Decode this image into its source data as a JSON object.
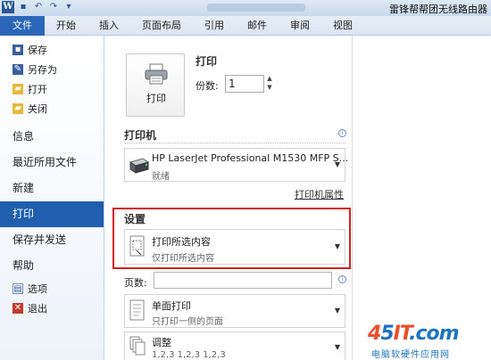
{
  "titlebar": {
    "brand": "雷锋帮帮团无线路由器"
  },
  "ribbon_tabs": [
    "文件",
    "开始",
    "插入",
    "页面布局",
    "引用",
    "邮件",
    "审阅",
    "视图"
  ],
  "nav": {
    "small_top": [
      {
        "icon": "save-icon",
        "label": "保存"
      },
      {
        "icon": "save-as-icon",
        "label": "另存为"
      },
      {
        "icon": "open-folder-icon",
        "label": "打开"
      },
      {
        "icon": "close-folder-icon",
        "label": "关闭"
      }
    ],
    "big": [
      "信息",
      "最近所用文件",
      "新建",
      "打印",
      "保存并发送",
      "帮助"
    ],
    "active": "打印",
    "small_bottom": [
      {
        "icon": "options-icon",
        "label": "选项"
      },
      {
        "icon": "exit-icon",
        "label": "退出"
      }
    ]
  },
  "print": {
    "section_title": "打印",
    "button_label": "打印",
    "copies_label": "份数:",
    "copies_value": "1"
  },
  "printer": {
    "section_title": "打印机",
    "name": "HP LaserJet Professional M1530 MFP S...",
    "status": "就绪",
    "properties_link": "打印机属性"
  },
  "settings": {
    "section_title": "设置",
    "scope_title": "打印所选内容",
    "scope_desc": "仅打印所选内容",
    "pages_label": "页数:",
    "sides_title": "单面打印",
    "sides_desc": "只打印一侧的页面",
    "collate_title": "调整",
    "collate_desc": "1,2,3    1,2,3    1,2,3"
  },
  "watermark": {
    "big_a": "4",
    "big_b": "5",
    "big_c": "IT",
    "big_d": ".com",
    "small": "电脑软硬件应用网"
  },
  "colors": {
    "accent": "#1f5fae",
    "highlight": "#d62020"
  }
}
